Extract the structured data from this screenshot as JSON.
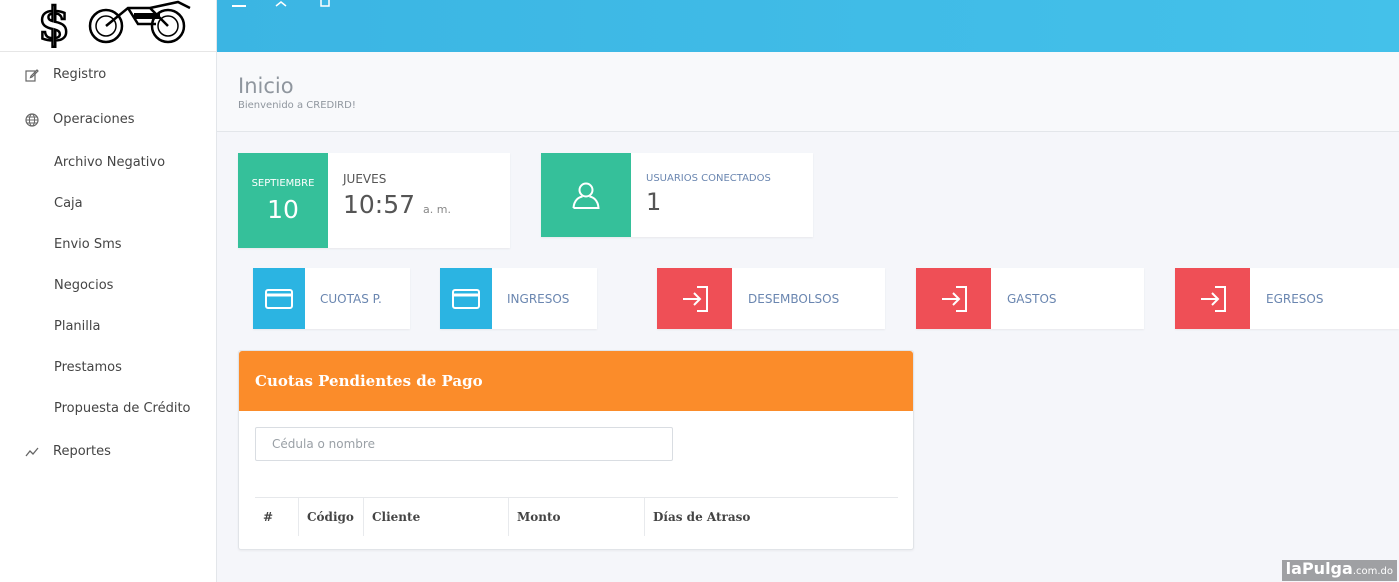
{
  "sidebar": {
    "items": [
      {
        "label": "Registro",
        "icon": "edit-icon"
      },
      {
        "label": "Operaciones",
        "icon": "globe-icon"
      },
      {
        "label": "Archivo Negativo"
      },
      {
        "label": "Caja"
      },
      {
        "label": "Envio Sms"
      },
      {
        "label": "Negocios"
      },
      {
        "label": "Planilla"
      },
      {
        "label": "Prestamos"
      },
      {
        "label": "Propuesta de Crédito"
      },
      {
        "label": "Reportes",
        "icon": "trend-line-icon"
      }
    ]
  },
  "page": {
    "title": "Inicio",
    "subtitle": "Bienvenido a CREDIRD!"
  },
  "date_card": {
    "month": "SEPTIEMBRE",
    "day": "10",
    "weekday": "JUEVES",
    "time": "10:57",
    "ampm": "a. m."
  },
  "users_card": {
    "label": "USUARIOS CONECTADOS",
    "count": "1"
  },
  "tiles": [
    {
      "label": "CUOTAS P.",
      "icon": "credit-card-icon",
      "color": "#2bb4e2"
    },
    {
      "label": "INGRESOS",
      "icon": "credit-card-icon",
      "color": "#2bb4e2"
    },
    {
      "label": "DESEMBOLSOS",
      "icon": "sign-in-icon",
      "color": "#ef4f56"
    },
    {
      "label": "GASTOS",
      "icon": "sign-in-icon",
      "color": "#ef4f56"
    },
    {
      "label": "EGRESOS",
      "icon": "sign-in-icon",
      "color": "#ef4f56"
    }
  ],
  "panel": {
    "title": "Cuotas Pendientes de Pago",
    "search_placeholder": "Cédula o nombre",
    "columns": [
      "#",
      "Código",
      "Cliente",
      "Monto",
      "Días de Atraso"
    ]
  },
  "colors": {
    "header": "#3bb5e3",
    "green": "#35c09a",
    "blue": "#2bb4e2",
    "red": "#ef4f56",
    "orange": "#fb8c2a"
  },
  "watermark": {
    "brand": "laPulga",
    "domain": ".com.do"
  }
}
